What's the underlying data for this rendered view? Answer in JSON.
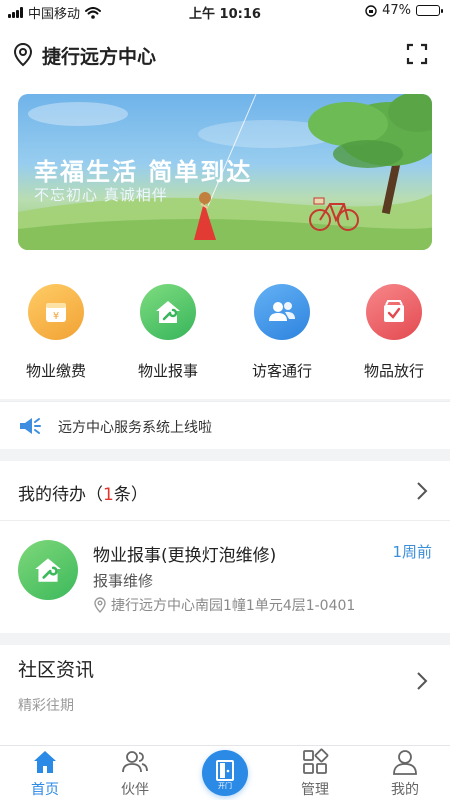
{
  "status_bar": {
    "carrier": "中国移动",
    "time": "上午 10:16",
    "battery": "47%",
    "battery_level": 0.47
  },
  "header": {
    "location": "捷行远方中心"
  },
  "banner": {
    "title": "幸福生活 简单到达",
    "subtitle": "不忘初心 真诚相伴"
  },
  "services": [
    {
      "label": "物业缴费",
      "icon": "wallet-icon",
      "color": "#f5b044"
    },
    {
      "label": "物业报事",
      "icon": "house-wrench-icon",
      "color": "#45c46a"
    },
    {
      "label": "访客通行",
      "icon": "visitors-icon",
      "color": "#3d93e8"
    },
    {
      "label": "物品放行",
      "icon": "box-check-icon",
      "color": "#ee5c5f"
    }
  ],
  "notice": {
    "text": "远方中心服务系统上线啦"
  },
  "todo": {
    "title": "我的待办",
    "count_open": "（",
    "count": "1",
    "count_close": "条）",
    "item": {
      "name": "物业报事(更换灯泡维修)",
      "time": "1周前",
      "type": "报事维修",
      "address": "捷行远方中心南园1幢1单元4层1-0401"
    }
  },
  "news": {
    "title": "社区资讯",
    "subtitle": "精彩往期"
  },
  "tabbar": {
    "active": "首页",
    "tabs": [
      {
        "label": "首页",
        "icon": "home-icon"
      },
      {
        "label": "伙伴",
        "icon": "partners-icon"
      },
      {
        "label": "",
        "icon": "door-icon"
      },
      {
        "label": "管理",
        "icon": "grid-icon"
      },
      {
        "label": "我的",
        "icon": "profile-icon"
      }
    ],
    "open_label": "开门"
  },
  "colors": {
    "accent": "#2b8ae6",
    "red": "#e0362c"
  }
}
